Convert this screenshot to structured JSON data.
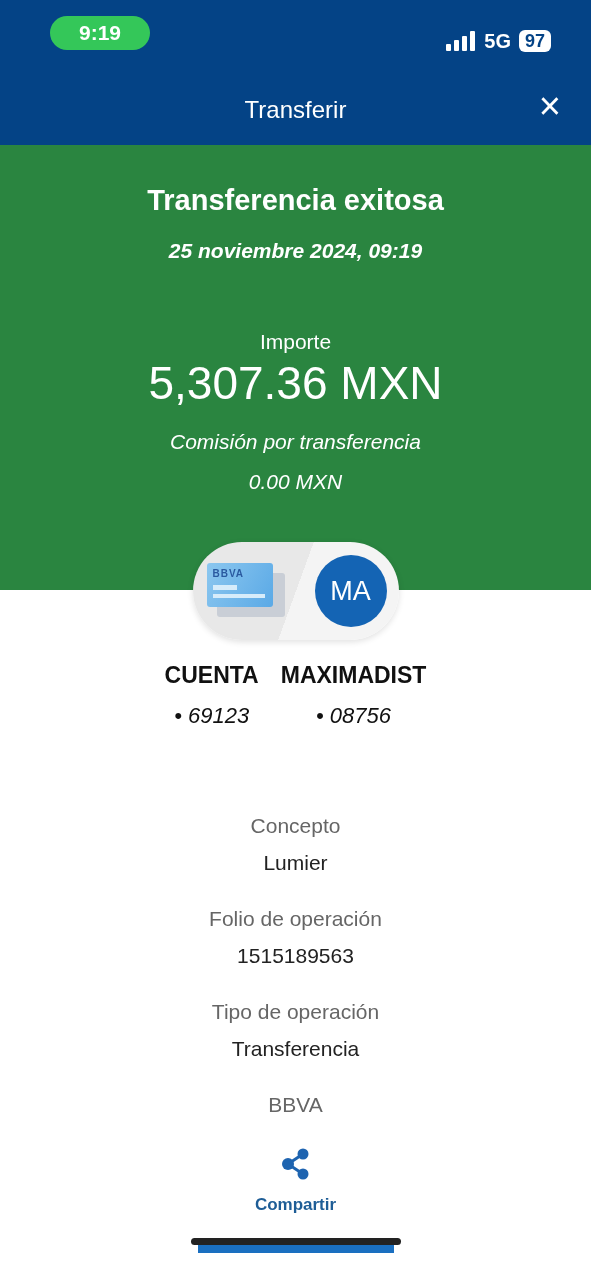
{
  "status_bar": {
    "time": "9:19",
    "network": "5G",
    "battery": "97"
  },
  "header": {
    "title": "Transferir",
    "close": "×"
  },
  "result": {
    "title": "Transferencia exitosa",
    "date": "25 noviembre 2024, 09:19",
    "amount_label": "Importe",
    "amount": "5,307.36 MXN",
    "fee_label": "Comisión por transferencia",
    "fee": "0.00 MXN"
  },
  "transfer": {
    "card_brand": "BBVA",
    "recipient_initials": "MA"
  },
  "accounts": [
    {
      "name": "CUENTA",
      "number": "• 69123"
    },
    {
      "name": "MAXIMADIST",
      "number": "• 08756"
    }
  ],
  "details": [
    {
      "label": "Concepto",
      "value": "Lumier"
    },
    {
      "label": "Folio de operación",
      "value": "1515189563"
    },
    {
      "label": "Tipo de operación",
      "value": "Transferencia"
    },
    {
      "label": "BBVA"
    }
  ],
  "share": {
    "label": "Compartir"
  }
}
